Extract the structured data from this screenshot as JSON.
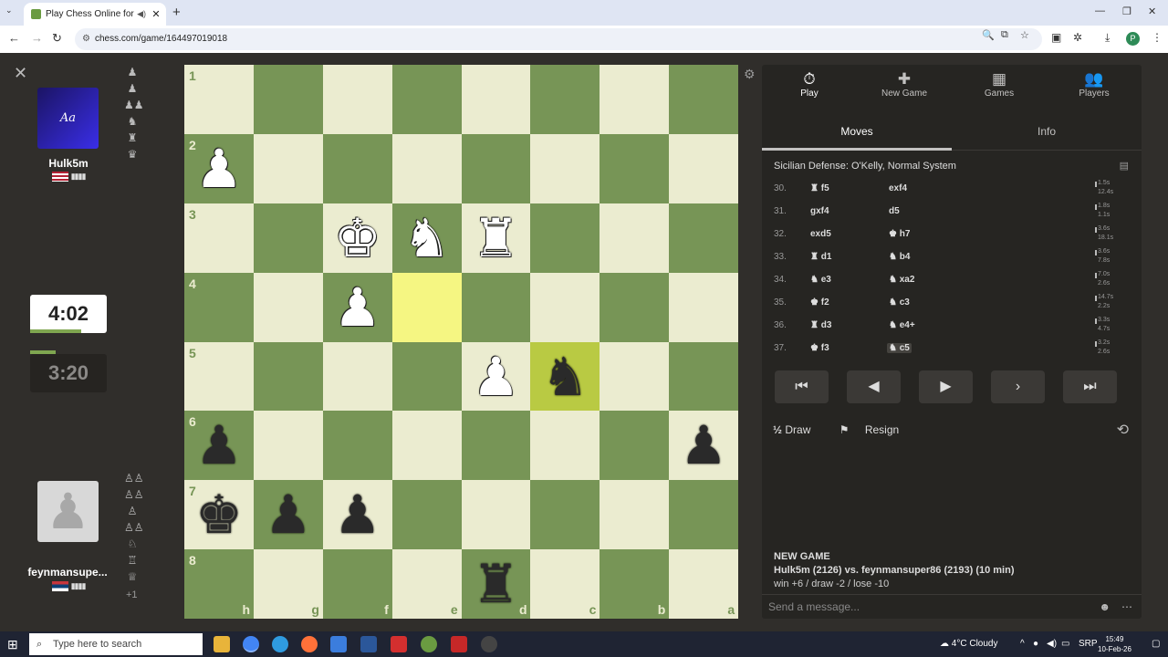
{
  "browser": {
    "tab_title": "Play Chess Online for FREE",
    "url": "chess.com/game/164497019018",
    "tab_close": "✕",
    "new_tab": "+",
    "profile_initial": "P"
  },
  "players": {
    "top": {
      "name": "Hulk5m",
      "avatar_text": "Aa",
      "clock": "4:02",
      "clock_progress": 0.67
    },
    "bottom": {
      "name": "feynmansupe...",
      "clock": "3:20",
      "clock_progress": 0.33,
      "captured_extra": "+1"
    }
  },
  "board": {
    "ranks": [
      "1",
      "2",
      "3",
      "4",
      "5",
      "6",
      "7",
      "8"
    ],
    "files": [
      "h",
      "g",
      "f",
      "e",
      "d",
      "c",
      "b",
      "a"
    ],
    "highlight_from": "e4",
    "highlight_to": "c5",
    "pieces": [
      {
        "sq": "h2",
        "color": "w",
        "glyph": "♟"
      },
      {
        "sq": "f3",
        "color": "w",
        "glyph": "♚"
      },
      {
        "sq": "e3",
        "color": "w",
        "glyph": "♞"
      },
      {
        "sq": "d3",
        "color": "w",
        "glyph": "♜"
      },
      {
        "sq": "f4",
        "color": "w",
        "glyph": "♟"
      },
      {
        "sq": "d5",
        "color": "w",
        "glyph": "♟"
      },
      {
        "sq": "c5",
        "color": "b",
        "glyph": "♞"
      },
      {
        "sq": "h6",
        "color": "b",
        "glyph": "♟"
      },
      {
        "sq": "a6",
        "color": "b",
        "glyph": "♟"
      },
      {
        "sq": "h7",
        "color": "b",
        "glyph": "♚"
      },
      {
        "sq": "g7",
        "color": "b",
        "glyph": "♟"
      },
      {
        "sq": "f7",
        "color": "b",
        "glyph": "♟"
      },
      {
        "sq": "d8",
        "color": "b",
        "glyph": "♜"
      }
    ]
  },
  "panel": {
    "tabs": [
      {
        "label": "Play",
        "icon": "⏱"
      },
      {
        "label": "New Game",
        "icon": "✚"
      },
      {
        "label": "Games",
        "icon": "▦"
      },
      {
        "label": "Players",
        "icon": "👥"
      }
    ],
    "subtabs": [
      "Moves",
      "Info"
    ],
    "opening": "Sicilian Defense: O'Kelly, Normal System",
    "moves": [
      {
        "num": "30.",
        "white": "♜ f5",
        "black": "exf4",
        "tw": "1.5s",
        "tb": "12.4s"
      },
      {
        "num": "31.",
        "white": "gxf4",
        "black": "d5",
        "tw": "1.8s",
        "tb": "1.1s"
      },
      {
        "num": "32.",
        "white": "exd5",
        "black": "♚ h7",
        "tw": "3.6s",
        "tb": "18.1s"
      },
      {
        "num": "33.",
        "white": "♜ d1",
        "black": "♞ b4",
        "tw": "3.6s",
        "tb": "7.8s"
      },
      {
        "num": "34.",
        "white": "♞ e3",
        "black": "♞ xa2",
        "tw": "7.0s",
        "tb": "2.6s"
      },
      {
        "num": "35.",
        "white": "♚ f2",
        "black": "♞ c3",
        "tw": "14.7s",
        "tb": "2.2s"
      },
      {
        "num": "36.",
        "white": "♜ d3",
        "black": "♞ e4+",
        "tw": "3.3s",
        "tb": "4.7s"
      },
      {
        "num": "37.",
        "white": "♚ f3",
        "black": "♞ c5",
        "tw": "3.2s",
        "tb": "2.6s"
      }
    ],
    "nav": [
      "⏮",
      "◀",
      "▶",
      "›",
      "⏭"
    ],
    "draw": "Draw",
    "draw_icon": "½",
    "resign": "Resign",
    "new_game_title": "NEW GAME",
    "new_game_line": "Hulk5m (2126) vs. feynmansuper86 (2193) (10 min)",
    "new_game_stakes": "win +6 / draw -2 / lose -10",
    "chat_placeholder": "Send a message..."
  },
  "taskbar": {
    "search": "Type here to search",
    "weather": "4°C  Cloudy",
    "lang": "SRP",
    "time": "15:49",
    "date": "10-Feb-26"
  }
}
